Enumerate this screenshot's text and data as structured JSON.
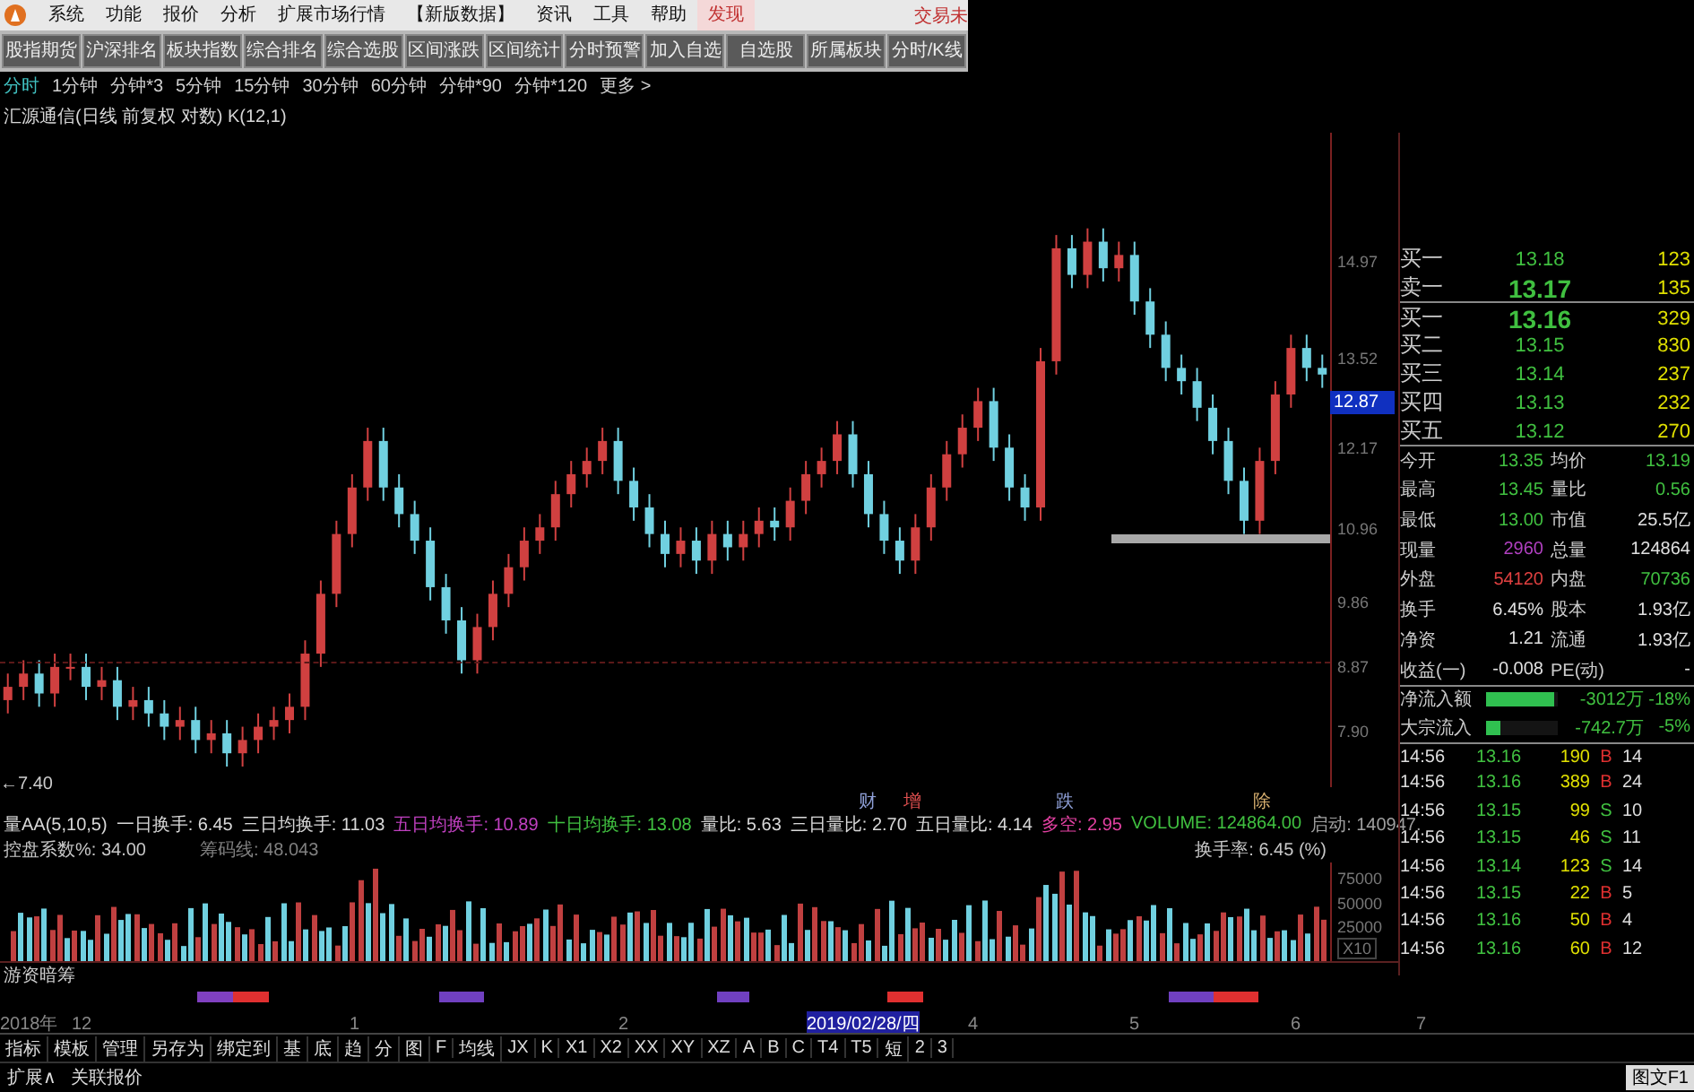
{
  "menu": {
    "items": [
      {
        "label": "系统",
        "selected": false
      },
      {
        "label": "功能",
        "selected": false
      },
      {
        "label": "报价",
        "selected": false
      },
      {
        "label": "分析",
        "selected": false
      },
      {
        "label": "扩展市场行情",
        "selected": false
      },
      {
        "label": "【新版数据】",
        "selected": false
      },
      {
        "label": "资讯",
        "selected": false
      },
      {
        "label": "工具",
        "selected": false
      },
      {
        "label": "帮助",
        "selected": false
      },
      {
        "label": "发现",
        "selected": true
      }
    ],
    "trade_link": "交易未"
  },
  "toolbar": [
    "股指期货",
    "沪深排名",
    "板块指数",
    "综合排名",
    "综合选股",
    "区间涨跌",
    "区间统计",
    "分时预警",
    "加入自选",
    "自选股",
    "所属板块",
    "分时/K线"
  ],
  "periods": [
    {
      "label": "分时",
      "selected": true
    },
    {
      "label": "1分钟",
      "selected": false
    },
    {
      "label": "分钟*3",
      "selected": false
    },
    {
      "label": "5分钟",
      "selected": false
    },
    {
      "label": "15分钟",
      "selected": false
    },
    {
      "label": "30分钟",
      "selected": false
    },
    {
      "label": "60分钟",
      "selected": false
    },
    {
      "label": "分钟*90",
      "selected": false
    },
    {
      "label": "分钟*120",
      "selected": false
    },
    {
      "label": "更多 >",
      "selected": false
    }
  ],
  "chart_title": "汇源通信(日线 前复权 对数) K(12,1)",
  "chart_data": {
    "type": "candlestick",
    "ylim": [
      7.09,
      16.94
    ],
    "yticks": [
      {
        "value": 14.97,
        "label": "14.97"
      },
      {
        "value": 13.52,
        "label": "13.52"
      },
      {
        "value": 12.17,
        "label": "12.17"
      },
      {
        "value": 10.96,
        "label": "10.96"
      },
      {
        "value": 9.86,
        "label": "9.86"
      },
      {
        "value": 8.87,
        "label": "8.87"
      },
      {
        "value": 7.9,
        "label": "7.90"
      }
    ],
    "ohlc": [
      [
        8.4,
        8.8,
        8.2,
        8.6
      ],
      [
        8.6,
        9.0,
        8.4,
        8.8
      ],
      [
        8.8,
        9.0,
        8.3,
        8.5
      ],
      [
        8.5,
        9.1,
        8.3,
        8.9
      ],
      [
        8.9,
        9.1,
        8.7,
        8.9
      ],
      [
        8.9,
        9.1,
        8.4,
        8.6
      ],
      [
        8.6,
        8.9,
        8.4,
        8.7
      ],
      [
        8.7,
        8.9,
        8.1,
        8.3
      ],
      [
        8.3,
        8.6,
        8.1,
        8.4
      ],
      [
        8.4,
        8.6,
        8.0,
        8.2
      ],
      [
        8.2,
        8.4,
        7.8,
        8.0
      ],
      [
        8.0,
        8.3,
        7.8,
        8.1
      ],
      [
        8.1,
        8.3,
        7.6,
        7.8
      ],
      [
        7.8,
        8.1,
        7.6,
        7.9
      ],
      [
        7.9,
        8.1,
        7.4,
        7.6
      ],
      [
        7.6,
        8.0,
        7.4,
        7.8
      ],
      [
        7.8,
        8.2,
        7.6,
        8.0
      ],
      [
        8.0,
        8.3,
        7.8,
        8.1
      ],
      [
        8.1,
        8.5,
        7.9,
        8.3
      ],
      [
        8.3,
        9.3,
        8.1,
        9.1
      ],
      [
        9.1,
        10.2,
        8.9,
        10.0
      ],
      [
        10.0,
        11.1,
        9.8,
        10.9
      ],
      [
        10.9,
        11.8,
        10.7,
        11.6
      ],
      [
        11.6,
        12.5,
        11.4,
        12.3
      ],
      [
        12.3,
        12.5,
        11.4,
        11.6
      ],
      [
        11.6,
        11.8,
        11.0,
        11.2
      ],
      [
        11.2,
        11.4,
        10.6,
        10.8
      ],
      [
        10.8,
        11.0,
        9.9,
        10.1
      ],
      [
        10.1,
        10.3,
        9.4,
        9.6
      ],
      [
        9.6,
        9.8,
        8.8,
        9.0
      ],
      [
        9.0,
        9.7,
        8.8,
        9.5
      ],
      [
        9.5,
        10.2,
        9.3,
        10.0
      ],
      [
        10.0,
        10.6,
        9.8,
        10.4
      ],
      [
        10.4,
        11.0,
        10.2,
        10.8
      ],
      [
        10.8,
        11.2,
        10.6,
        11.0
      ],
      [
        11.0,
        11.7,
        10.8,
        11.5
      ],
      [
        11.5,
        12.0,
        11.3,
        11.8
      ],
      [
        11.8,
        12.2,
        11.6,
        12.0
      ],
      [
        12.0,
        12.5,
        11.8,
        12.3
      ],
      [
        12.3,
        12.5,
        11.5,
        11.7
      ],
      [
        11.7,
        11.9,
        11.1,
        11.3
      ],
      [
        11.3,
        11.5,
        10.7,
        10.9
      ],
      [
        10.9,
        11.1,
        10.4,
        10.6
      ],
      [
        10.6,
        11.0,
        10.4,
        10.8
      ],
      [
        10.8,
        11.0,
        10.3,
        10.5
      ],
      [
        10.5,
        11.1,
        10.3,
        10.9
      ],
      [
        10.9,
        11.1,
        10.5,
        10.7
      ],
      [
        10.7,
        11.1,
        10.5,
        10.9
      ],
      [
        10.9,
        11.3,
        10.7,
        11.1
      ],
      [
        11.1,
        11.3,
        10.8,
        11.0
      ],
      [
        11.0,
        11.6,
        10.8,
        11.4
      ],
      [
        11.4,
        12.0,
        11.2,
        11.8
      ],
      [
        11.8,
        12.2,
        11.6,
        12.0
      ],
      [
        12.0,
        12.6,
        11.8,
        12.4
      ],
      [
        12.4,
        12.6,
        11.6,
        11.8
      ],
      [
        11.8,
        12.0,
        11.0,
        11.2
      ],
      [
        11.2,
        11.4,
        10.6,
        10.8
      ],
      [
        10.8,
        11.0,
        10.3,
        10.5
      ],
      [
        10.5,
        11.2,
        10.3,
        11.0
      ],
      [
        11.0,
        11.8,
        10.8,
        11.6
      ],
      [
        11.6,
        12.3,
        11.4,
        12.1
      ],
      [
        12.1,
        12.7,
        11.9,
        12.5
      ],
      [
        12.5,
        13.1,
        12.3,
        12.9
      ],
      [
        12.9,
        13.1,
        12.0,
        12.2
      ],
      [
        12.2,
        12.4,
        11.4,
        11.6
      ],
      [
        11.6,
        11.8,
        11.1,
        11.3
      ],
      [
        11.3,
        13.7,
        11.1,
        13.5
      ],
      [
        13.5,
        15.4,
        13.3,
        15.2
      ],
      [
        15.2,
        15.4,
        14.6,
        14.8
      ],
      [
        14.8,
        15.5,
        14.6,
        15.3
      ],
      [
        15.3,
        15.5,
        14.7,
        14.9
      ],
      [
        14.9,
        15.3,
        14.7,
        15.1
      ],
      [
        15.1,
        15.3,
        14.2,
        14.4
      ],
      [
        14.4,
        14.6,
        13.7,
        13.9
      ],
      [
        13.9,
        14.1,
        13.2,
        13.4
      ],
      [
        13.4,
        13.6,
        13.0,
        13.2
      ],
      [
        13.2,
        13.4,
        12.6,
        12.8
      ],
      [
        12.8,
        13.0,
        12.1,
        12.3
      ],
      [
        12.3,
        12.5,
        11.5,
        11.7
      ],
      [
        11.7,
        11.9,
        10.9,
        11.1
      ],
      [
        11.1,
        12.2,
        10.9,
        12.0
      ],
      [
        12.0,
        13.2,
        11.8,
        13.0
      ],
      [
        13.0,
        13.9,
        12.8,
        13.7
      ],
      [
        13.7,
        13.9,
        13.2,
        13.4
      ],
      [
        13.4,
        13.6,
        13.1,
        13.3
      ]
    ]
  },
  "current_price_tag": "12.87",
  "low_marker": "←7.40",
  "event_markers": [
    {
      "label": "财",
      "color": "#8fa0d8"
    },
    {
      "label": "增",
      "color": "#e05050"
    },
    {
      "label": "跌",
      "color": "#8fa0d8"
    },
    {
      "label": "除",
      "color": "#d8b070"
    }
  ],
  "indicator_line": [
    {
      "text": "量AA(5,10,5)",
      "color": "#d8d8d8"
    },
    {
      "text": "一日换手: 6.45",
      "color": "#d8d8d8"
    },
    {
      "text": "三日均换手: 11.03",
      "color": "#d8d8d8"
    },
    {
      "text": "五日均换手: 10.89",
      "color": "#c040c0"
    },
    {
      "text": "十日均换手: 13.08",
      "color": "#40c040"
    },
    {
      "text": "量比: 5.63",
      "color": "#d8d8d8"
    },
    {
      "text": "三日量比: 2.70",
      "color": "#d8d8d8"
    },
    {
      "text": "五日量比: 4.14",
      "color": "#d8d8d8"
    },
    {
      "text": "多空: 2.95",
      "color": "#e040a0"
    },
    {
      "text": "VOLUME: 124864.00",
      "color": "#40c040"
    },
    {
      "text": "启动: 140947.",
      "color": "#a0a0a0"
    }
  ],
  "indicator_line_2": [
    {
      "text": "控盘系数%: 34.00",
      "color": "#c8c8c8"
    },
    {
      "text": "筹码线: 48.043",
      "color": "#808080"
    }
  ],
  "turnover_label": "换手率: 6.45  (%)",
  "volume_axis": [
    "75000",
    "50000",
    "25000"
  ],
  "volume_scale": "X10",
  "signal_title": "游资暗筹",
  "date_axis": [
    {
      "label": "2018年",
      "selected": false
    },
    {
      "label": "12",
      "selected": false
    },
    {
      "label": "1",
      "selected": false
    },
    {
      "label": "2",
      "selected": false
    },
    {
      "label": "2019/02/28/四",
      "selected": true
    },
    {
      "label": "4",
      "selected": false
    },
    {
      "label": "5",
      "selected": false
    },
    {
      "label": "6",
      "selected": false
    },
    {
      "label": "7",
      "selected": false
    }
  ],
  "bottom_toolbar": [
    "指标",
    "模板",
    "管理",
    "另存为",
    "绑定到",
    "基",
    "底",
    "趋",
    "分",
    "图",
    "F",
    "均线",
    "JX",
    "K",
    "X1",
    "X2",
    "XX",
    "XY",
    "XZ",
    "A",
    "B",
    "C",
    "T4",
    "T5",
    "短",
    "2",
    "3"
  ],
  "status_bar": {
    "left": [
      "扩展∧",
      "关联报价"
    ],
    "right": "图文F1"
  },
  "quote": {
    "order_book": [
      {
        "label": "买一",
        "price": "13.18",
        "volume": "123",
        "big": false
      },
      {
        "label": "卖一",
        "price": "13.17",
        "volume": "135",
        "big": true
      },
      {
        "label": "买一",
        "price": "13.16",
        "volume": "329",
        "big": true
      },
      {
        "label": "买二",
        "price": "13.15",
        "volume": "830",
        "big": false
      },
      {
        "label": "买三",
        "price": "13.14",
        "volume": "237",
        "big": false
      },
      {
        "label": "买四",
        "price": "13.13",
        "volume": "232",
        "big": false
      },
      {
        "label": "买五",
        "price": "13.12",
        "volume": "270",
        "big": false
      }
    ],
    "stats": [
      {
        "left": {
          "label": "今开",
          "value": "13.35",
          "color": "#40c040"
        },
        "right": {
          "label": "均价",
          "value": "13.19",
          "color": "#40c040"
        }
      },
      {
        "left": {
          "label": "最高",
          "value": "13.45",
          "color": "#40c040"
        },
        "right": {
          "label": "量比",
          "value": "0.56",
          "color": "#40c040"
        }
      },
      {
        "left": {
          "label": "最低",
          "value": "13.00",
          "color": "#40c040"
        },
        "right": {
          "label": "市值",
          "value": "25.5亿",
          "color": "#e0e0e0"
        }
      },
      {
        "left": {
          "label": "现量",
          "value": "2960",
          "color": "#b040c0"
        },
        "right": {
          "label": "总量",
          "value": "124864",
          "color": "#e0e0e0"
        }
      },
      {
        "left": {
          "label": "外盘",
          "value": "54120",
          "color": "#e04040"
        },
        "right": {
          "label": "内盘",
          "value": "70736",
          "color": "#40c040"
        }
      },
      {
        "left": {
          "label": "换手",
          "value": "6.45%",
          "color": "#e0e0e0"
        },
        "right": {
          "label": "股本",
          "value": "1.93亿",
          "color": "#e0e0e0"
        }
      },
      {
        "left": {
          "label": "净资",
          "value": "1.21",
          "color": "#e0e0e0"
        },
        "right": {
          "label": "流通",
          "value": "1.93亿",
          "color": "#e0e0e0"
        }
      },
      {
        "left": {
          "label": "收益(一)",
          "value": "-0.008",
          "color": "#e0e0e0"
        },
        "right": {
          "label": "PE(动)",
          "value": "-",
          "color": "#e0e0e0"
        }
      }
    ],
    "flows": [
      {
        "label": "净流入额",
        "level": 0.95,
        "amount": "-3012万",
        "percent": "-18%"
      },
      {
        "label": "大宗流入",
        "level": 0.2,
        "amount": "-742.7万",
        "percent": "-5%"
      }
    ],
    "trades": [
      {
        "time": "14:56",
        "price": "13.16",
        "volume": "190",
        "side": "B",
        "column_5": "14"
      },
      {
        "time": "14:56",
        "price": "13.16",
        "volume": "389",
        "side": "B",
        "column_5": "24"
      },
      {
        "time": "14:56",
        "price": "13.15",
        "volume": "99",
        "side": "S",
        "column_5": "10"
      },
      {
        "time": "14:56",
        "price": "13.15",
        "volume": "46",
        "side": "S",
        "column_5": "11"
      },
      {
        "time": "14:56",
        "price": "13.14",
        "volume": "123",
        "side": "S",
        "column_5": "14"
      },
      {
        "time": "14:56",
        "price": "13.15",
        "volume": "22",
        "side": "B",
        "column_5": "5"
      },
      {
        "time": "14:56",
        "price": "13.16",
        "volume": "50",
        "side": "B",
        "column_5": "4"
      },
      {
        "time": "14:56",
        "price": "13.16",
        "volume": "60",
        "side": "B",
        "column_5": "12"
      }
    ]
  }
}
